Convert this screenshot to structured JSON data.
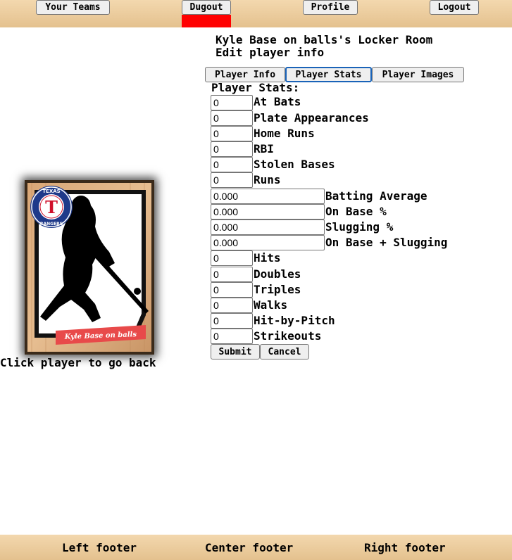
{
  "nav": {
    "your_teams": "Your Teams",
    "dugout": "Dugout",
    "profile": "Profile",
    "logout": "Logout"
  },
  "header": {
    "title": "Kyle Base on balls's Locker Room",
    "subtitle": "Edit player info"
  },
  "tabs": {
    "info": "Player Info",
    "stats": "Player Stats",
    "images": "Player Images",
    "active": "Player Stats"
  },
  "stats": {
    "heading": "Player Stats:",
    "fields": [
      {
        "label": "At Bats",
        "value": "0"
      },
      {
        "label": "Plate Appearances",
        "value": "0"
      },
      {
        "label": "Home Runs",
        "value": "0"
      },
      {
        "label": "RBI",
        "value": "0"
      },
      {
        "label": "Stolen Bases",
        "value": "0"
      },
      {
        "label": "Runs",
        "value": "0"
      },
      {
        "label": "Batting Average",
        "value": "0.000"
      },
      {
        "label": "On Base %",
        "value": "0.000"
      },
      {
        "label": "Slugging %",
        "value": "0.000"
      },
      {
        "label": "On Base + Slugging",
        "value": "0.000"
      },
      {
        "label": "Hits",
        "value": "0"
      },
      {
        "label": "Doubles",
        "value": "0"
      },
      {
        "label": "Triples",
        "value": "0"
      },
      {
        "label": "Walks",
        "value": "0"
      },
      {
        "label": "Hit-by-Pitch",
        "value": "0"
      },
      {
        "label": "Strikeouts",
        "value": "0"
      }
    ],
    "submit": "Submit",
    "cancel": "Cancel"
  },
  "card": {
    "player_name": "Kyle Base on balls",
    "logo_top": "TEXAS",
    "logo_letter": "T",
    "logo_bottom": "RANGERS",
    "back_hint": "Click player to go back"
  },
  "footer": {
    "left": "Left footer",
    "center": "Center footer",
    "right": "Right footer"
  },
  "colors": {
    "header_bg": "#e8c697",
    "dugout_marker": "#ff0000",
    "active_tab_border": "#1a63b8",
    "card_banner": "#e84a4a"
  }
}
